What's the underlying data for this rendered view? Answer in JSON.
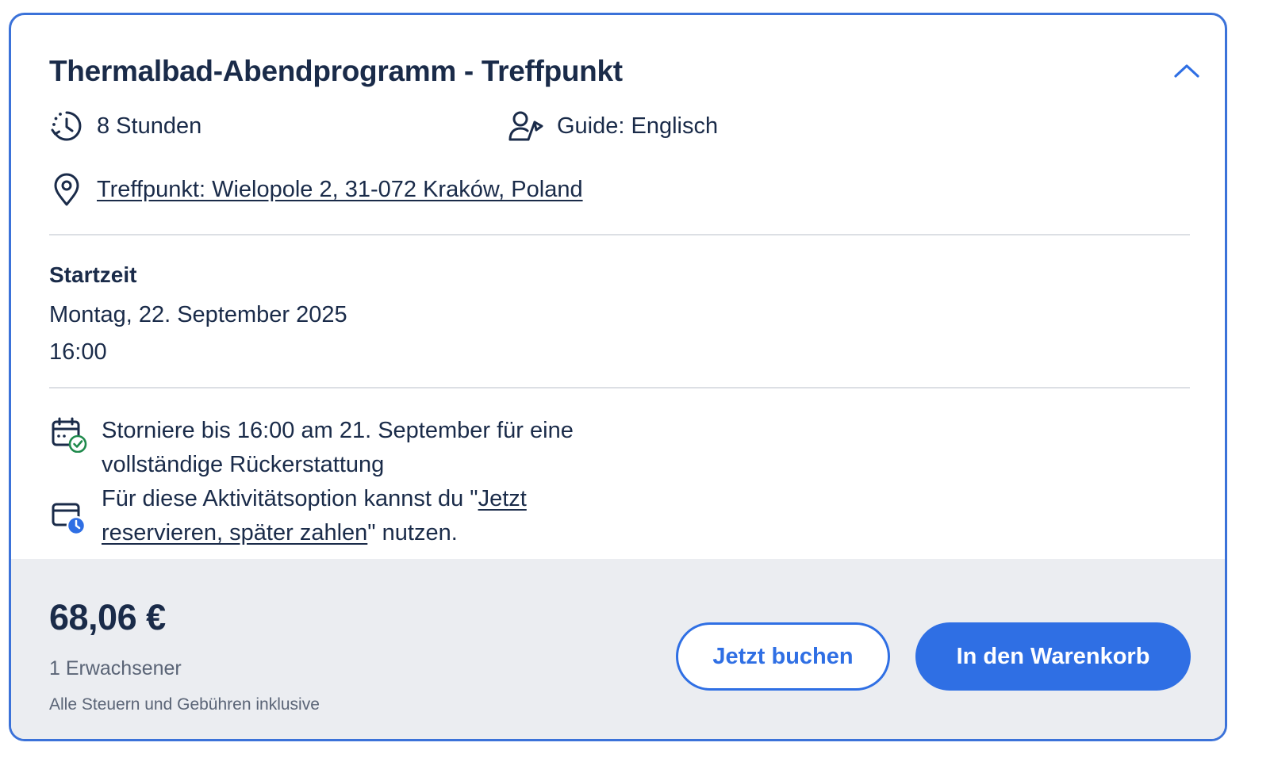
{
  "activity": {
    "title": "Thermalbad-Abendprogramm - Treffpunkt",
    "duration": "8 Stunden",
    "guide": "Guide: Englisch",
    "meeting_point": "Treffpunkt: Wielopole 2, 31-072 Kraków, Poland"
  },
  "start": {
    "label": "Startzeit",
    "date": "Montag, 22. September 2025",
    "time": "16:00"
  },
  "policies": {
    "cancellation": "Storniere bis 16:00 am 21. September für eine vollständige Rückerstattung",
    "reserve_prefix": "Für diese Aktivitätsoption kannst du \"",
    "reserve_link": "Jetzt reservieren, später zahlen",
    "reserve_suffix": "\" nutzen."
  },
  "pricing": {
    "price": "68,06 €",
    "participants": "1 Erwachsener",
    "taxes_note": "Alle Steuern und Gebühren inklusive"
  },
  "buttons": {
    "book_now": "Jetzt buchen",
    "add_to_cart": "In den Warenkorb"
  },
  "icons": {
    "collapse": "chevron-up-icon",
    "duration": "clock-history-icon",
    "guide": "guide-person-flag-icon",
    "location": "map-pin-icon",
    "cancellation": "calendar-check-icon",
    "reserve": "card-clock-icon"
  },
  "colors": {
    "accent": "#2f6fe4",
    "border": "#3b72d9",
    "text": "#1a2b49",
    "muted": "#5a6476",
    "footer_bg": "#ebedf1",
    "check_green": "#1f8a4c"
  }
}
